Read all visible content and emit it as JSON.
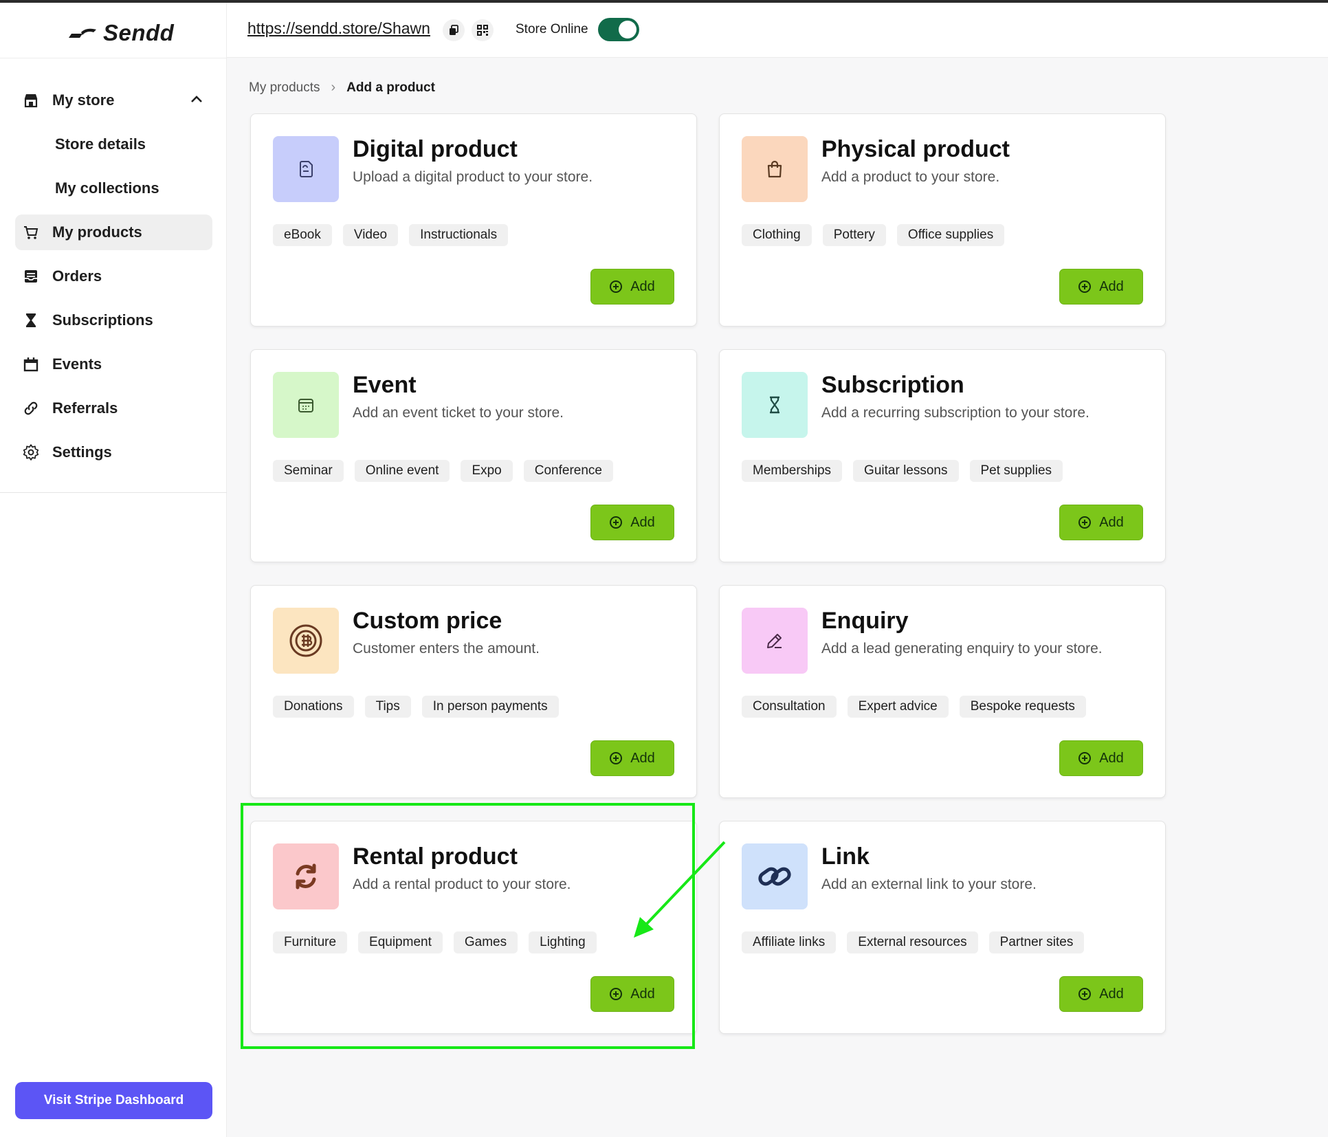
{
  "app": {
    "logo_text": "Sendd"
  },
  "header": {
    "store_url": "https://sendd.store/Shawn",
    "store_online_label": "Store Online",
    "store_online": true
  },
  "sidebar": {
    "my_store": "My store",
    "store_details": "Store details",
    "my_collections": "My collections",
    "items": [
      {
        "label": "My products",
        "icon": "cart-icon"
      },
      {
        "label": "Orders",
        "icon": "inbox-icon"
      },
      {
        "label": "Subscriptions",
        "icon": "hourglass-icon"
      },
      {
        "label": "Events",
        "icon": "calendar-icon"
      },
      {
        "label": "Referrals",
        "icon": "link-icon"
      },
      {
        "label": "Settings",
        "icon": "gear-icon"
      }
    ],
    "stripe_button": "Visit Stripe Dashboard"
  },
  "breadcrumb": {
    "parent": "My products",
    "current": "Add a product"
  },
  "add_label": "Add",
  "cards": [
    {
      "title": "Digital product",
      "desc": "Upload a digital product to your store.",
      "chips": [
        "eBook",
        "Video",
        "Instructionals"
      ],
      "color": "#c7cdfb",
      "icon": "document-icon"
    },
    {
      "title": "Physical product",
      "desc": "Add a product to your store.",
      "chips": [
        "Clothing",
        "Pottery",
        "Office supplies"
      ],
      "color": "#fbd7bd",
      "icon": "shopping-bag-icon"
    },
    {
      "title": "Event",
      "desc": "Add an event ticket to your store.",
      "chips": [
        "Seminar",
        "Online event",
        "Expo",
        "Conference"
      ],
      "color": "#d6f7c9",
      "icon": "calendar-icon"
    },
    {
      "title": "Subscription",
      "desc": "Add a recurring subscription to your store.",
      "chips": [
        "Memberships",
        "Guitar lessons",
        "Pet supplies"
      ],
      "color": "#c6f5ec",
      "icon": "hourglass-icon"
    },
    {
      "title": "Custom price",
      "desc": "Customer enters the amount.",
      "chips": [
        "Donations",
        "Tips",
        "In person payments"
      ],
      "color": "#fce5c0",
      "icon": "coin-icon"
    },
    {
      "title": "Enquiry",
      "desc": "Add a lead generating enquiry to your store.",
      "chips": [
        "Consultation",
        "Expert advice",
        "Bespoke requests"
      ],
      "color": "#f8c9f6",
      "icon": "pencil-icon"
    },
    {
      "title": "Rental product",
      "desc": "Add a rental product to your store.",
      "chips": [
        "Furniture",
        "Equipment",
        "Games",
        "Lighting"
      ],
      "color": "#fbc8cb",
      "icon": "refresh-icon"
    },
    {
      "title": "Link",
      "desc": "Add an external link to your store.",
      "chips": [
        "Affiliate links",
        "External resources",
        "Partner sites"
      ],
      "color": "#cfe1fb",
      "icon": "link-icon"
    }
  ]
}
